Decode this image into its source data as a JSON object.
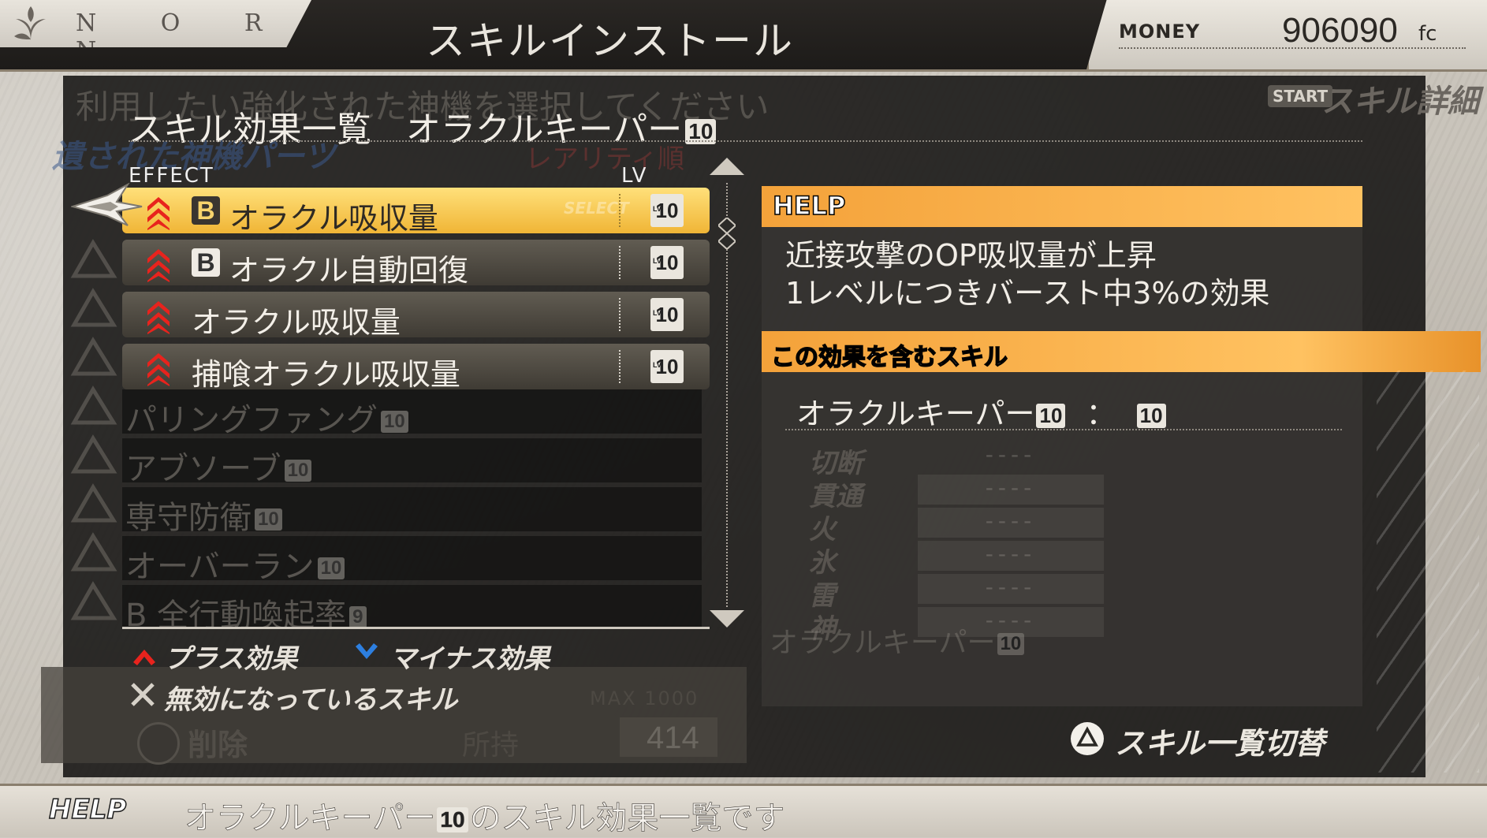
{
  "header": {
    "logo_text": "N O R N",
    "screen_title": "スキルインストール",
    "money_label": "MONEY",
    "money_value": "906090",
    "money_unit": "fc"
  },
  "panel": {
    "ghost_title": "利用したい強化された神機を選択してください",
    "ghost_subtitle": "遺された神機パーツ",
    "ghost_sort": "レアリティ順",
    "title": "スキル効果一覧　オラクルキーパー",
    "title_lv": "10",
    "start_badge": "START",
    "start_label": "スキル詳細",
    "col_effect": "EFFECT",
    "col_lv": "LV"
  },
  "effects": [
    {
      "name": "オラクル吸収量",
      "b": "B",
      "lv": "10",
      "select_ghost": "SELECT"
    },
    {
      "name": "オラクル自動回復",
      "b": "B",
      "lv": "10"
    },
    {
      "name": "オラクル吸収量",
      "b": "",
      "lv": "10"
    },
    {
      "name": "捕喰オラクル吸収量",
      "b": "",
      "lv": "10"
    }
  ],
  "faded_list": [
    {
      "name": "パリングファング",
      "lv": "10"
    },
    {
      "name": "アブソーブ",
      "lv": "10"
    },
    {
      "name": "専守防衛",
      "lv": "10"
    },
    {
      "name": "オーバーラン",
      "lv": "10"
    },
    {
      "name": "B 全行動喚起率",
      "lv": "9"
    }
  ],
  "legend": {
    "plus": "プラス効果",
    "minus": "マイナス効果",
    "disabled": "無効になっているスキル",
    "delete": "削除",
    "max": "MAX 1000",
    "own_label": "所持",
    "own_value": "414"
  },
  "help": {
    "header": "HELP",
    "line1": "近接攻撃のOP吸収量が上昇",
    "line2": "1レベルにつきバースト中3%の効果",
    "contains_header": "この効果を含むスキル",
    "contains_item": "オラクルキーパー",
    "contains_item_lv": "10",
    "contains_sep": "：",
    "contains_value_lv": "10",
    "ghost_stats": [
      {
        "label": "切断",
        "value": "----"
      },
      {
        "label": "貫通",
        "value": "----"
      },
      {
        "label": "火",
        "value": "----"
      },
      {
        "label": "氷",
        "value": "----"
      },
      {
        "label": "雷",
        "value": "----"
      },
      {
        "label": "神",
        "value": "----"
      }
    ],
    "ghost_name": "オラクルキーパー",
    "ghost_name_lv": "10",
    "switch_label": "スキル一覧切替"
  },
  "bottom": {
    "help_tag": "HELP",
    "text_name": "オラクルキーパー",
    "text_lv": "10",
    "text_rest": "のスキル効果一覧です"
  },
  "colors": {
    "accent_orange": "#f4a23a",
    "selected_row": "#f6c24e",
    "plus_red": "#e8231d",
    "minus_blue": "#2d7fe0"
  }
}
